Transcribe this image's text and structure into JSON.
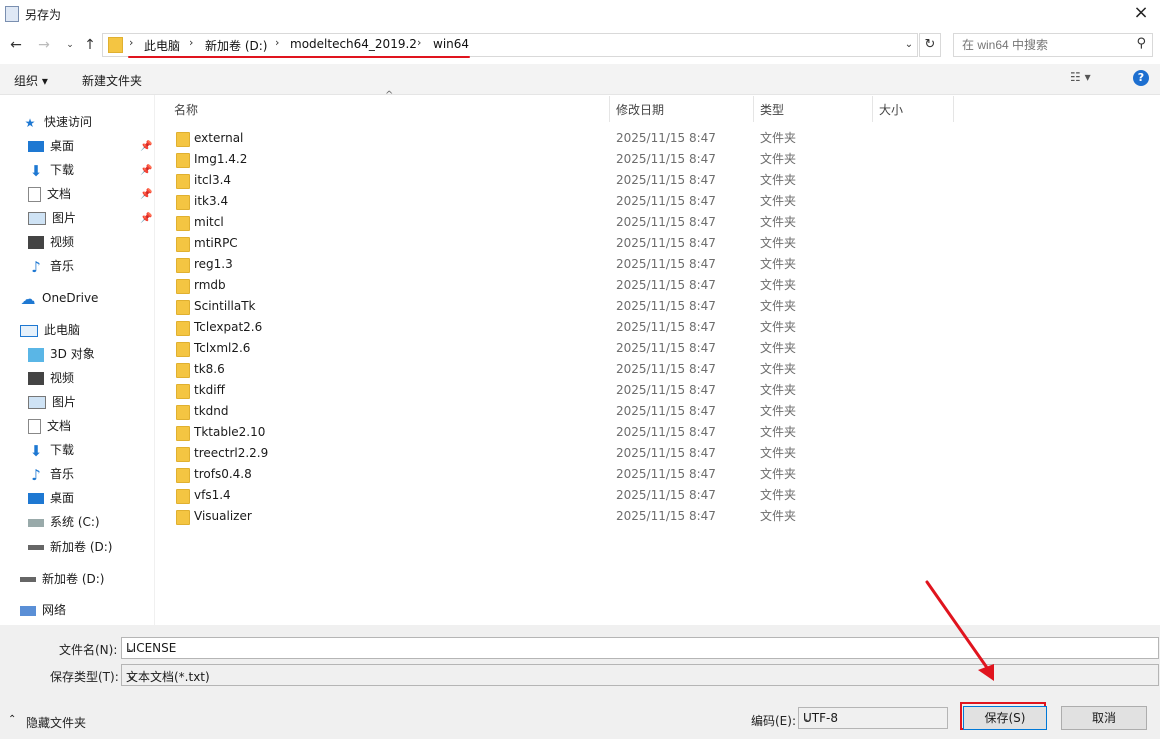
{
  "window": {
    "title": "另存为",
    "close_glyph": "×"
  },
  "address": {
    "crumbs": [
      "此电脑",
      "新加卷 (D:)",
      "modeltech64_2019.2",
      "win64"
    ],
    "separator": "›"
  },
  "search": {
    "placeholder": "在 win64 中搜索"
  },
  "toolbar": {
    "organize_label": "组织 ▾",
    "new_folder_label": "新建文件夹",
    "view_glyph": "☷ ▾",
    "help_glyph": "?"
  },
  "sidebar": {
    "quick_access": "快速访问",
    "qa_items": [
      "桌面",
      "下载",
      "文档",
      "图片",
      "视频",
      "音乐"
    ],
    "onedrive": "OneDrive",
    "this_pc": "此电脑",
    "pc_items": [
      "3D 对象",
      "视频",
      "图片",
      "文档",
      "下载",
      "音乐",
      "桌面",
      "系统 (C:)",
      "新加卷 (D:)"
    ],
    "drive_d": "新加卷 (D:)",
    "network": "网络"
  },
  "columns": {
    "name": "名称",
    "modified": "修改日期",
    "type": "类型",
    "size": "大小"
  },
  "files": [
    {
      "name": "external",
      "date": "2025/11/15 8:47",
      "type": "文件夹"
    },
    {
      "name": "Img1.4.2",
      "date": "2025/11/15 8:47",
      "type": "文件夹"
    },
    {
      "name": "itcl3.4",
      "date": "2025/11/15 8:47",
      "type": "文件夹"
    },
    {
      "name": "itk3.4",
      "date": "2025/11/15 8:47",
      "type": "文件夹"
    },
    {
      "name": "mitcl",
      "date": "2025/11/15 8:47",
      "type": "文件夹"
    },
    {
      "name": "mtiRPC",
      "date": "2025/11/15 8:47",
      "type": "文件夹"
    },
    {
      "name": "reg1.3",
      "date": "2025/11/15 8:47",
      "type": "文件夹"
    },
    {
      "name": "rmdb",
      "date": "2025/11/15 8:47",
      "type": "文件夹"
    },
    {
      "name": "ScintillaTk",
      "date": "2025/11/15 8:47",
      "type": "文件夹"
    },
    {
      "name": "Tclexpat2.6",
      "date": "2025/11/15 8:47",
      "type": "文件夹"
    },
    {
      "name": "Tclxml2.6",
      "date": "2025/11/15 8:47",
      "type": "文件夹"
    },
    {
      "name": "tk8.6",
      "date": "2025/11/15 8:47",
      "type": "文件夹"
    },
    {
      "name": "tkdiff",
      "date": "2025/11/15 8:47",
      "type": "文件夹"
    },
    {
      "name": "tkdnd",
      "date": "2025/11/15 8:47",
      "type": "文件夹"
    },
    {
      "name": "Tktable2.10",
      "date": "2025/11/15 8:47",
      "type": "文件夹"
    },
    {
      "name": "treectrl2.2.9",
      "date": "2025/11/15 8:47",
      "type": "文件夹"
    },
    {
      "name": "trofs0.4.8",
      "date": "2025/11/15 8:47",
      "type": "文件夹"
    },
    {
      "name": "vfs1.4",
      "date": "2025/11/15 8:47",
      "type": "文件夹"
    },
    {
      "name": "Visualizer",
      "date": "2025/11/15 8:47",
      "type": "文件夹"
    }
  ],
  "bottom": {
    "filename_label": "文件名(N):",
    "filename_value": "LICENSE",
    "filetype_label": "保存类型(T):",
    "filetype_value": "文本文档(*.txt)",
    "encoding_label": "编码(E):",
    "encoding_value": "UTF-8",
    "save_label": "保存(S)",
    "cancel_label": "取消",
    "hide_folders_label": "隐藏文件夹"
  },
  "colors": {
    "annotation_red": "#e0141e",
    "folder_yellow": "#f4c542",
    "accent_blue": "#0078d7"
  }
}
